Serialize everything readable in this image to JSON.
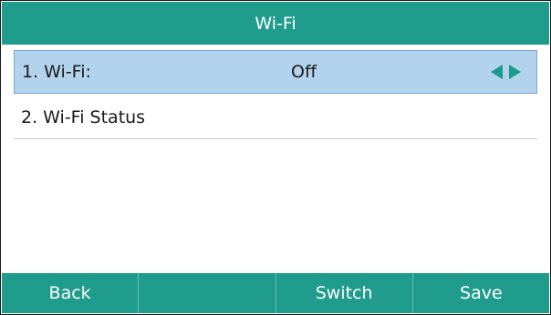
{
  "title": "Wi-Fi",
  "menu": {
    "items": [
      {
        "label": "1. Wi-Fi:",
        "value": "Off"
      },
      {
        "label": "2. Wi-Fi Status"
      }
    ]
  },
  "softkeys": [
    "Back",
    "",
    "Switch",
    "Save"
  ],
  "colors": {
    "accent": "#1f9c8c",
    "selected_row": "#b3d2ec",
    "arrow": "#1a9a89"
  }
}
